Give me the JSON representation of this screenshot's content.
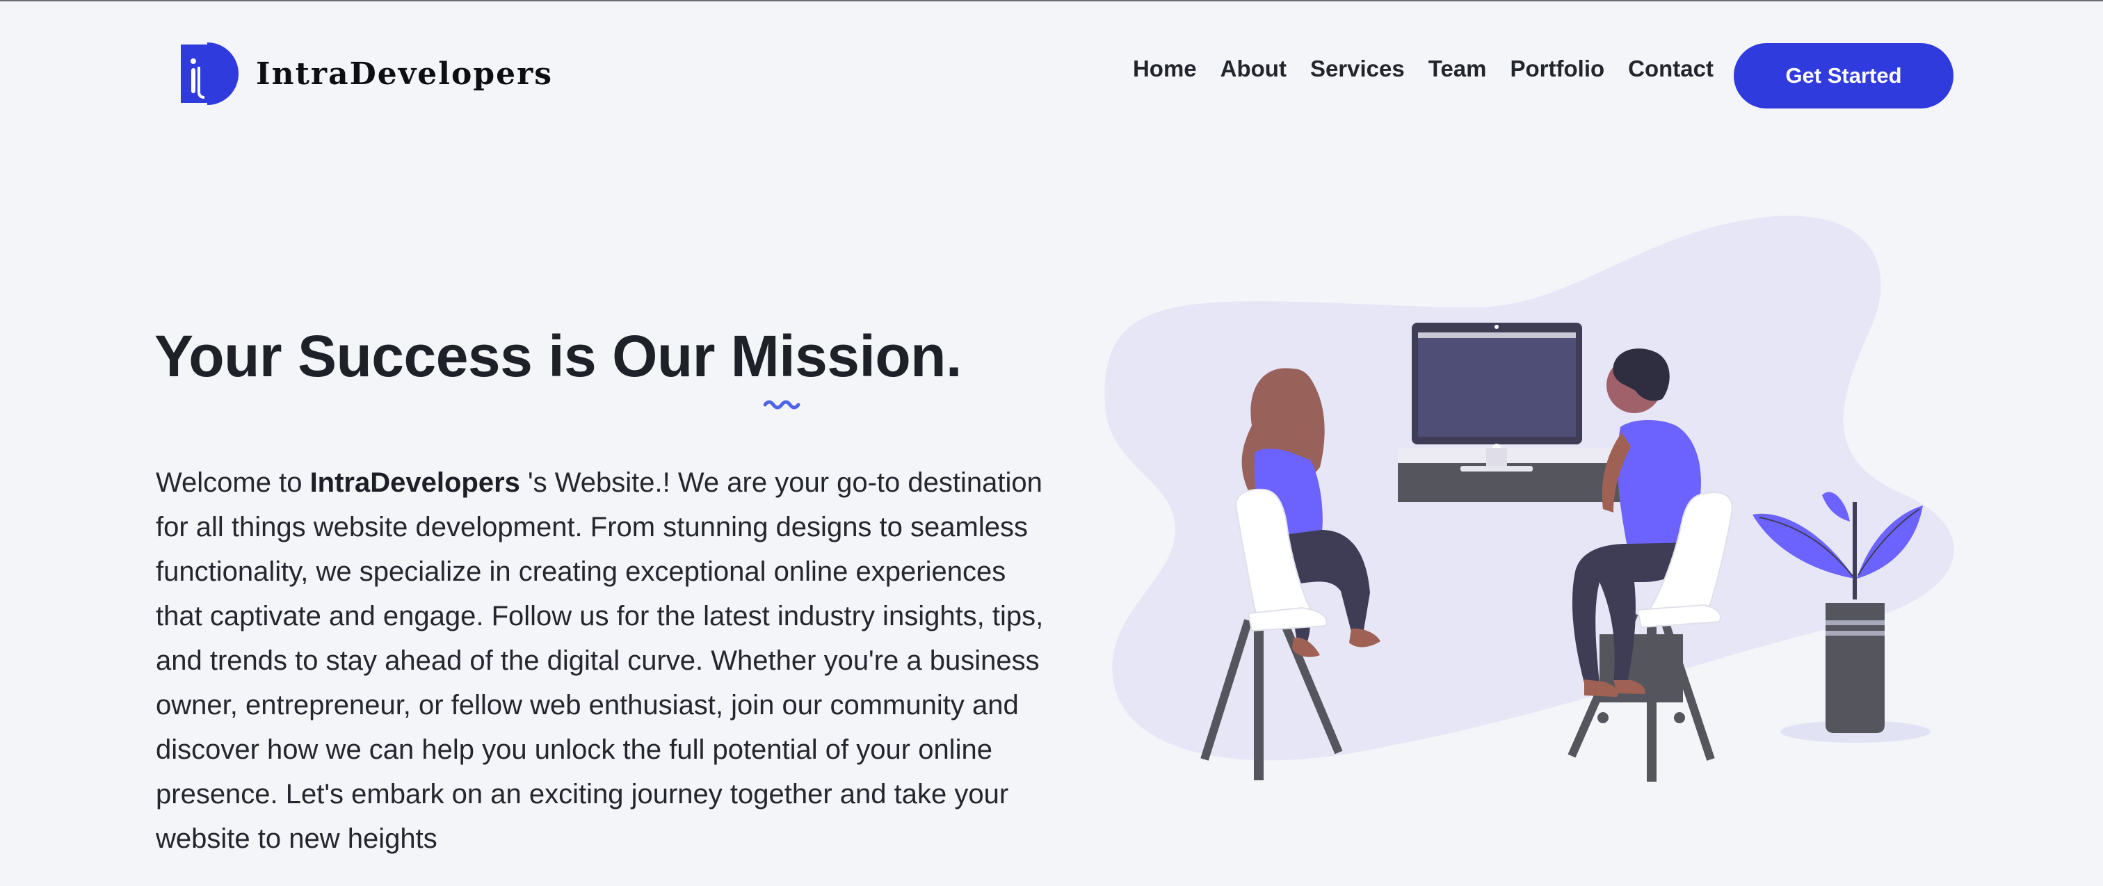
{
  "header": {
    "logo_text": "IntraDevelopers",
    "logo_icon": "id-monogram-icon",
    "nav": {
      "home": "Home",
      "about": "About",
      "services": "Services",
      "team": "Team",
      "portfolio": "Portfolio",
      "contact": "Contact"
    },
    "cta_label": "Get Started"
  },
  "hero": {
    "title": "Your Success is Our Mission.",
    "intro_prefix": "Welcome to ",
    "brand": "IntraDevelopers",
    "intro_body": " 's Website.! We are your go-to destination for all things website development. From stunning designs to seamless functionality, we specialize in creating exceptional online experiences that captivate and engage. Follow us for the latest industry insights, tips, and trends to stay ahead of the digital curve. Whether you're a business owner, entrepreneur, or fellow web enthusiast, join our community and discover how we can help you unlock the full potential of your online presence. Let's embark on an exciting journey together and take your website to new heights"
  },
  "colors": {
    "accent": "#2f3bdc",
    "illustration_purple": "#6c63ff",
    "blob": "#e6e6f7",
    "background": "#f4f5f8"
  }
}
